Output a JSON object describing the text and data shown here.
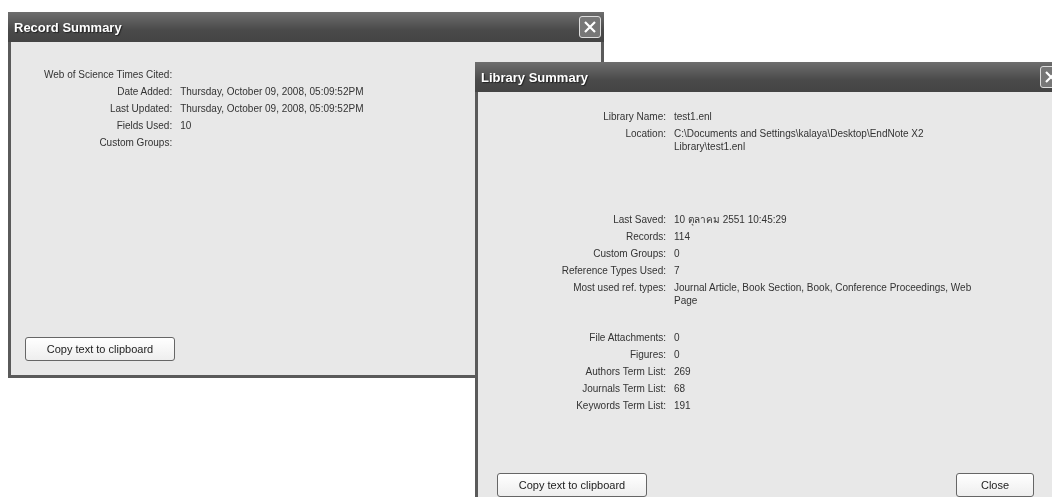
{
  "windows": [
    {
      "title": "Record Summary",
      "groups": [
        [
          {
            "label": "Web of Science Times Cited:"
          },
          {
            "label": "Date Added:",
            "value": "Thursday, October 09, 2008, 05:09:52PM"
          },
          {
            "label": "Last Updated:",
            "value": "Thursday, October 09, 2008, 05:09:52PM"
          },
          {
            "label": "Fields Used:",
            "value": "10"
          },
          {
            "label": "Custom Groups:"
          }
        ]
      ],
      "buttons": [
        {
          "label": "Copy text to clipboard",
          "kind": "left"
        }
      ]
    },
    {
      "title": "Library Summary",
      "groups": [
        [
          {
            "label": "Library Name:",
            "value": "test1.enl"
          },
          {
            "label": "Location:",
            "value": "C:\\Documents and Settings\\kalaya\\Desktop\\EndNote X2 Library\\test1.enl"
          }
        ],
        [
          {
            "label": "Last Saved:",
            "value": "10 ตุลาคม 2551 10:45:29"
          },
          {
            "label": "Records:",
            "value": "114"
          },
          {
            "label": "Custom Groups:",
            "value": "0"
          },
          {
            "label": "Reference Types Used:",
            "value": "7"
          },
          {
            "label": "Most used ref. types:",
            "value": "Journal Article, Book Section, Book, Conference Proceedings, Web Page"
          }
        ],
        [
          {
            "label": "File Attachments:",
            "value": "0"
          },
          {
            "label": "Figures:",
            "value": "0"
          },
          {
            "label": "Authors Term List:",
            "value": "269"
          },
          {
            "label": "Journals Term List:",
            "value": "68"
          },
          {
            "label": "Keywords Term List:",
            "value": "191"
          }
        ]
      ],
      "buttons": [
        {
          "label": "Copy text to clipboard",
          "kind": "left"
        },
        {
          "label": "Close",
          "kind": "right"
        }
      ]
    }
  ]
}
